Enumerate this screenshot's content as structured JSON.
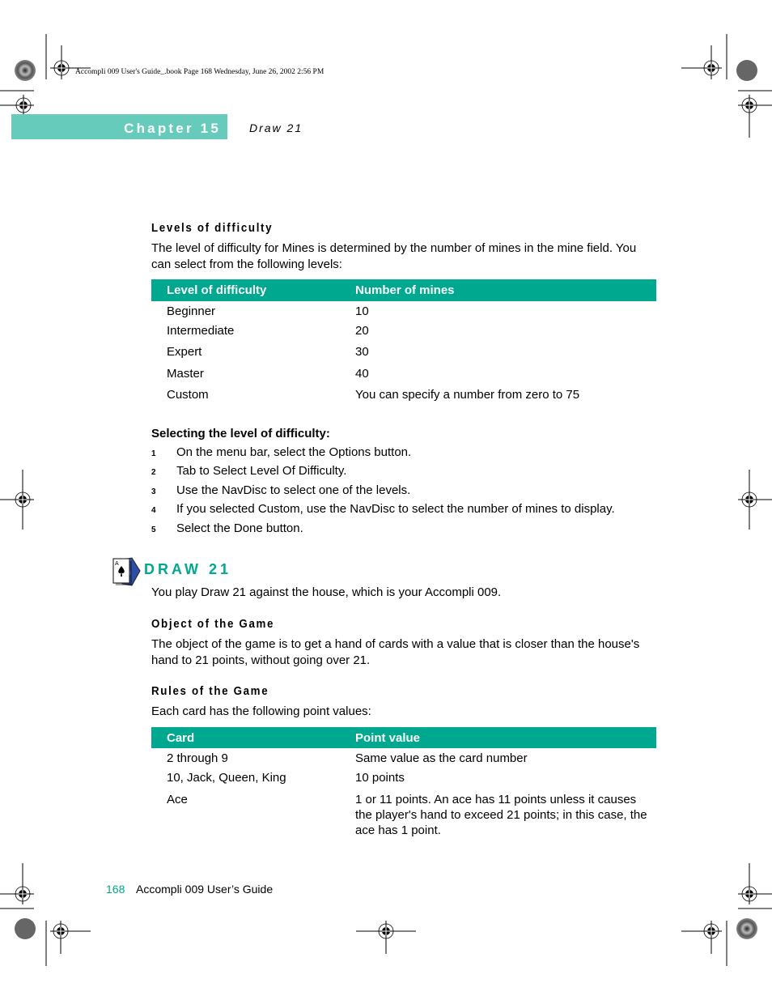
{
  "print_info": "Accompli 009 User's Guide_.book  Page 168  Wednesday, June 26, 2002  2:56 PM",
  "header": {
    "chapter_label": "Chapter 15",
    "chapter_title": "Draw 21"
  },
  "mines_section": {
    "heading": "Levels of difficulty",
    "intro_line1": "The level of difficulty for Mines is determined by the number of mines in the mine field. You",
    "intro_line2": "can select from the following levels:",
    "table": {
      "columns": [
        "Level of difficulty",
        "Number of mines"
      ],
      "rows": [
        [
          "Beginner",
          "10"
        ],
        [
          "Intermediate",
          "20"
        ],
        [
          "Expert",
          "30"
        ],
        [
          "Master",
          "40"
        ],
        [
          "Custom",
          "You can specify a number from zero to 75"
        ]
      ]
    },
    "procedure_title": "Selecting the level of difficulty:",
    "steps": [
      {
        "num": "1",
        "text": "On the menu bar, select the Options button."
      },
      {
        "num": "2",
        "text": "Tab to Select Level Of Difficulty."
      },
      {
        "num": "3",
        "text": "Use the NavDisc to select one of the levels."
      },
      {
        "num": "4",
        "text": "If you selected Custom, use the NavDisc to select the number of mines to display."
      },
      {
        "num": "5",
        "text": "Select the Done button."
      }
    ]
  },
  "draw21_section": {
    "icon": "playing-card-ace-of-spades-icon",
    "heading": "DRAW 21",
    "intro": "You play Draw 21 against the house, which is your Accompli 009.",
    "object_heading": "Object of the Game",
    "object_line1": "The object of the game is to get a hand of cards with a value that is closer than the house's",
    "object_line2": "hand to 21 points, without going over 21.",
    "rules_heading": "Rules of the Game",
    "rules_intro": "Each card has the following point values:",
    "table": {
      "columns": [
        "Card",
        "Point value"
      ],
      "rows": [
        [
          "2 through 9",
          "Same value as the card number"
        ],
        [
          "10, Jack, Queen, King",
          "10 points"
        ],
        [
          "Ace",
          "1 or 11 points. An ace has 11 points unless it causes the player's hand to exceed 21 points; in this case, the ace has 1 point."
        ]
      ]
    }
  },
  "footer": {
    "page_number": "168",
    "book_title": "Accompli 009 User’s Guide"
  },
  "colors": {
    "accent": "#00a88f",
    "chapter_bar": "#66cbbb"
  }
}
